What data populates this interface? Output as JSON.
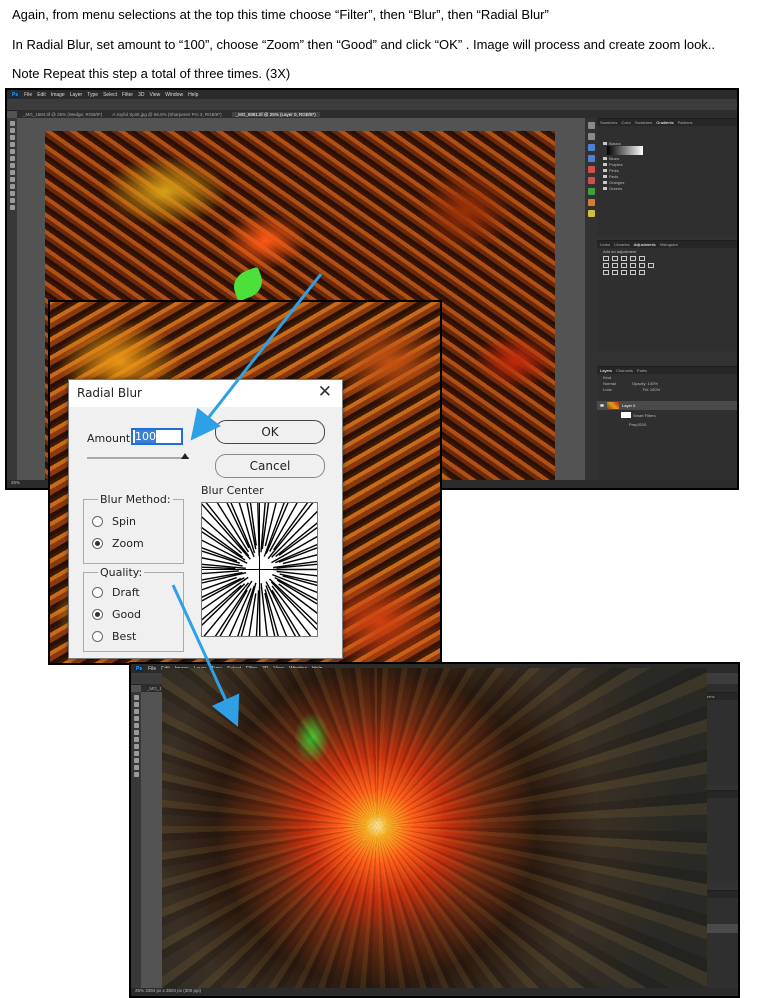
{
  "instructions": {
    "line1": "Again, from menu selections at the top this time choose “Filter”, then “Blur”, then “Radial Blur”",
    "line2": "In Radial Blur, set amount to “100”, choose “Zoom” then “Good” and click “OK” .  Image will process and create zoom look..",
    "line3": "Note Repeat this step a total of three times. (3X)"
  },
  "ps": {
    "logo": "Ps",
    "menu": [
      "File",
      "Edit",
      "Image",
      "Layer",
      "Type",
      "Select",
      "Filter",
      "3D",
      "View",
      "Window",
      "Help"
    ],
    "tabs": [
      "_MG_1584.tif @ 25% (Wedge, RGB/8*)",
      "A Joyful Spirit.jpg @ 66.5% (Sharpener Pro 3, RGB/8*)",
      "_MG_6981.tif @ 25% (Layer 0, RGB/8*)"
    ],
    "status": "25%",
    "status2": "25%      3394 px x 3504 px (300 ppi)",
    "panels": {
      "top_tabs": [
        "Swatches",
        "Color",
        "Swatches",
        "Gradients",
        "Patterns"
      ],
      "gradient_groups": [
        "Basics",
        "Blues",
        "Purples",
        "Pinks",
        "Reds",
        "Oranges",
        "Greens"
      ],
      "adj_tabs": [
        "Learn",
        "Libraries",
        "Adjustments",
        "Histogram"
      ],
      "adj_title": "Add an adjustment",
      "layer_tabs": [
        "Layers",
        "Channels",
        "Paths"
      ],
      "blend_mode": "Normal",
      "opacity": "Opacity: 100%",
      "lock": "Lock:",
      "fill": "Fill: 100%",
      "kind": "Kind",
      "layer_name": "Layer 0",
      "smart_filters": "Smart Filters",
      "filter_1": "Prep2010",
      "filter_radial": "Radial Blur"
    }
  },
  "dialog": {
    "title": "Radial Blur",
    "close": "✕",
    "amount_label": "Amount",
    "amount_value": "100",
    "amount_fraction": 1.0,
    "ok": "OK",
    "cancel": "Cancel",
    "blur_method_label": "Blur Method:",
    "methods": [
      "Spin",
      "Zoom"
    ],
    "method_selected": "Zoom",
    "quality_label": "Quality:",
    "qualities": [
      "Draft",
      "Good",
      "Best"
    ],
    "quality_selected": "Good",
    "center_label": "Blur Center"
  },
  "colors": {
    "arrow": "#2ea0e6",
    "ps_bg": "#535353",
    "dialog_bg": "#f0f0f0",
    "ok_border": "#444444"
  }
}
